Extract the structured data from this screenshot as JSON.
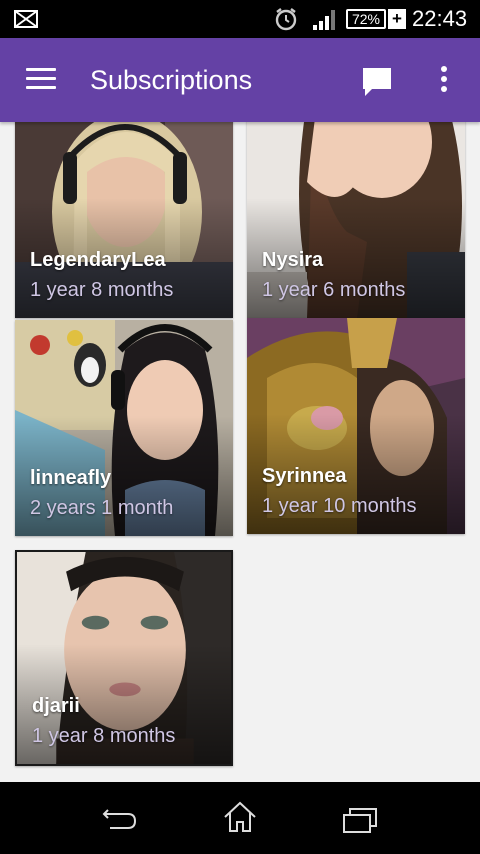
{
  "status_bar": {
    "icons": [
      "mail-icon",
      "alarm-icon",
      "signal-icon",
      "battery-icon",
      "charging-icon"
    ],
    "battery": "72%",
    "charging_symbol": "+",
    "time": "22:43"
  },
  "app_bar": {
    "title": "Subscriptions",
    "color": "#6441a5",
    "left_icon": "menu-icon",
    "right_icons": [
      "chat-icon",
      "overflow-menu-icon"
    ]
  },
  "subscriptions": [
    {
      "name": "LegendaryLea",
      "duration": "1 year 8 months"
    },
    {
      "name": "Nysira",
      "duration": "1 year 6 months"
    },
    {
      "name": "linneafly",
      "duration": "2 years 1 month"
    },
    {
      "name": "Syrinnea",
      "duration": "1 year 10 months"
    },
    {
      "name": "djarii",
      "duration": "1 year 8 months"
    }
  ],
  "nav_bar": {
    "icons": [
      "back-icon",
      "home-icon",
      "recent-apps-icon"
    ]
  }
}
